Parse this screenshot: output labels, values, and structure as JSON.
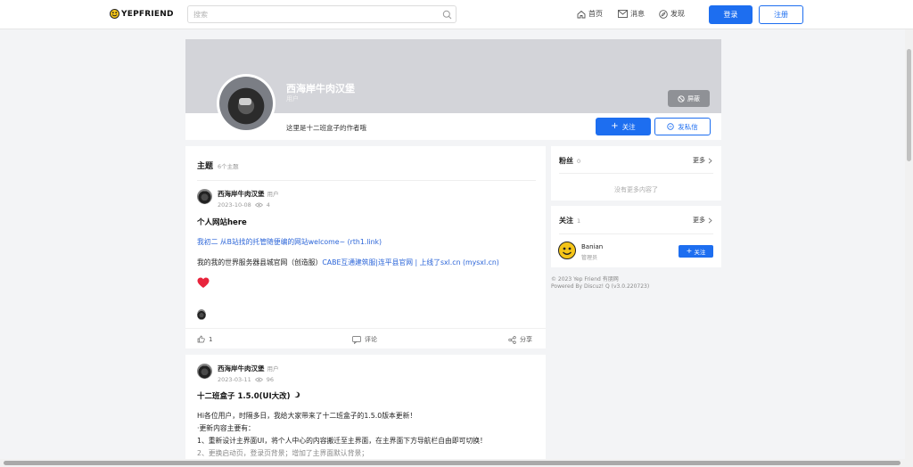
{
  "header": {
    "logo_text": "YEPFRIEND",
    "search_placeholder": "搜索",
    "nav": [
      {
        "label": "首页",
        "icon": "home-icon"
      },
      {
        "label": "消息",
        "icon": "mail-icon"
      },
      {
        "label": "发现",
        "icon": "compass-icon"
      }
    ],
    "login_label": "登录",
    "register_label": "注册"
  },
  "profile": {
    "name": "西海岸牛肉汉堡",
    "role": "用户",
    "bio": "这里是十二班盒子的作者哦",
    "block_label": "屏蔽",
    "follow_label": "关注",
    "message_label": "发私信"
  },
  "topics": {
    "title": "主题",
    "count": "6个主题"
  },
  "posts": [
    {
      "author": "西海岸牛肉汉堡",
      "role": "用户",
      "date": "2023-10-08",
      "views": "4",
      "title": "个人网站here",
      "line1_link": "我初二 从B站找的托管随便编的网站welcome~ (rth1.link)",
      "line2_text": "我的我的世界服务器县城官网（创造服）",
      "line2_link": "CABE互通建筑服|连平县官网 | 上线了sxl.cn (mysxl.cn)",
      "likes": "1",
      "comment_label": "评论",
      "share_label": "分享"
    },
    {
      "author": "西海岸牛肉汉堡",
      "role": "用户",
      "date": "2023-03-11",
      "views": "96",
      "title": "十二班盒子 1.5.0(UI大改)",
      "lines": [
        "Hi各位用户，时隔多日，我给大家带来了十二班盒子的1.5.0版本更新！",
        "·更新内容主要有：",
        "1、重新设计主界面UI，将个人中心的内容搬迁至主界面，在主界面下方导航栏自由即可切换！",
        "2、更换启动页，登录页背景；增加了主界面默认背景；"
      ]
    }
  ],
  "sidebar": {
    "fans": {
      "title": "粉丝",
      "count": "0",
      "more": "更多",
      "empty": "没有更多内容了"
    },
    "following": {
      "title": "关注",
      "count": "1",
      "more": "更多",
      "user": {
        "name": "Banian",
        "role": "管理员",
        "follow_label": "关注"
      }
    },
    "footer": [
      "© 2023 Yep Friend 有朋网",
      "Powered By Discuz! Q (v3.0.220723)"
    ]
  },
  "colors": {
    "accent": "#1d6ef0",
    "link": "#2a64d8",
    "banner": "#d3d4d9"
  }
}
